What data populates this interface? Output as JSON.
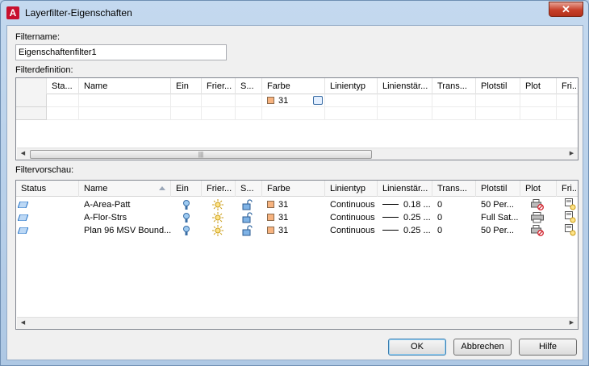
{
  "window": {
    "title": "Layerfilter-Eigenschaften",
    "close_label": "✕"
  },
  "filtername": {
    "label": "Filtername:",
    "value": "Eigenschaftenfilter1"
  },
  "definition": {
    "label": "Filterdefinition:",
    "columns": [
      "Sta...",
      "Name",
      "Ein",
      "Frier...",
      "S...",
      "Farbe",
      "Linientyp",
      "Linienstär...",
      "Trans...",
      "Plotstil",
      "Plot",
      "Fri..."
    ],
    "row_color": "31"
  },
  "preview": {
    "label": "Filtervorschau:",
    "columns": [
      "Status",
      "Name",
      "Ein",
      "Frier...",
      "S...",
      "Farbe",
      "Linientyp",
      "Linienstär...",
      "Trans...",
      "Plotstil",
      "Plot",
      "Fri..."
    ],
    "rows": [
      {
        "name": "A-Area-Patt",
        "color": "31",
        "linetype": "Continuous",
        "lineweight": "0.18 ...",
        "transparency": "0",
        "plotstyle": "50 Per..."
      },
      {
        "name": "A-Flor-Strs",
        "color": "31",
        "linetype": "Continuous",
        "lineweight": "0.25 ...",
        "transparency": "0",
        "plotstyle": "Full Sat..."
      },
      {
        "name": "Plan 96 MSV Bound...",
        "color": "31",
        "linetype": "Continuous",
        "lineweight": "0.25 ...",
        "transparency": "0",
        "plotstyle": "50 Per..."
      }
    ]
  },
  "buttons": {
    "ok": "OK",
    "cancel": "Abbrechen",
    "help": "Hilfe"
  },
  "colors": {
    "swatch": "#f7b37f",
    "layer_icon": "#1f6fc5"
  }
}
